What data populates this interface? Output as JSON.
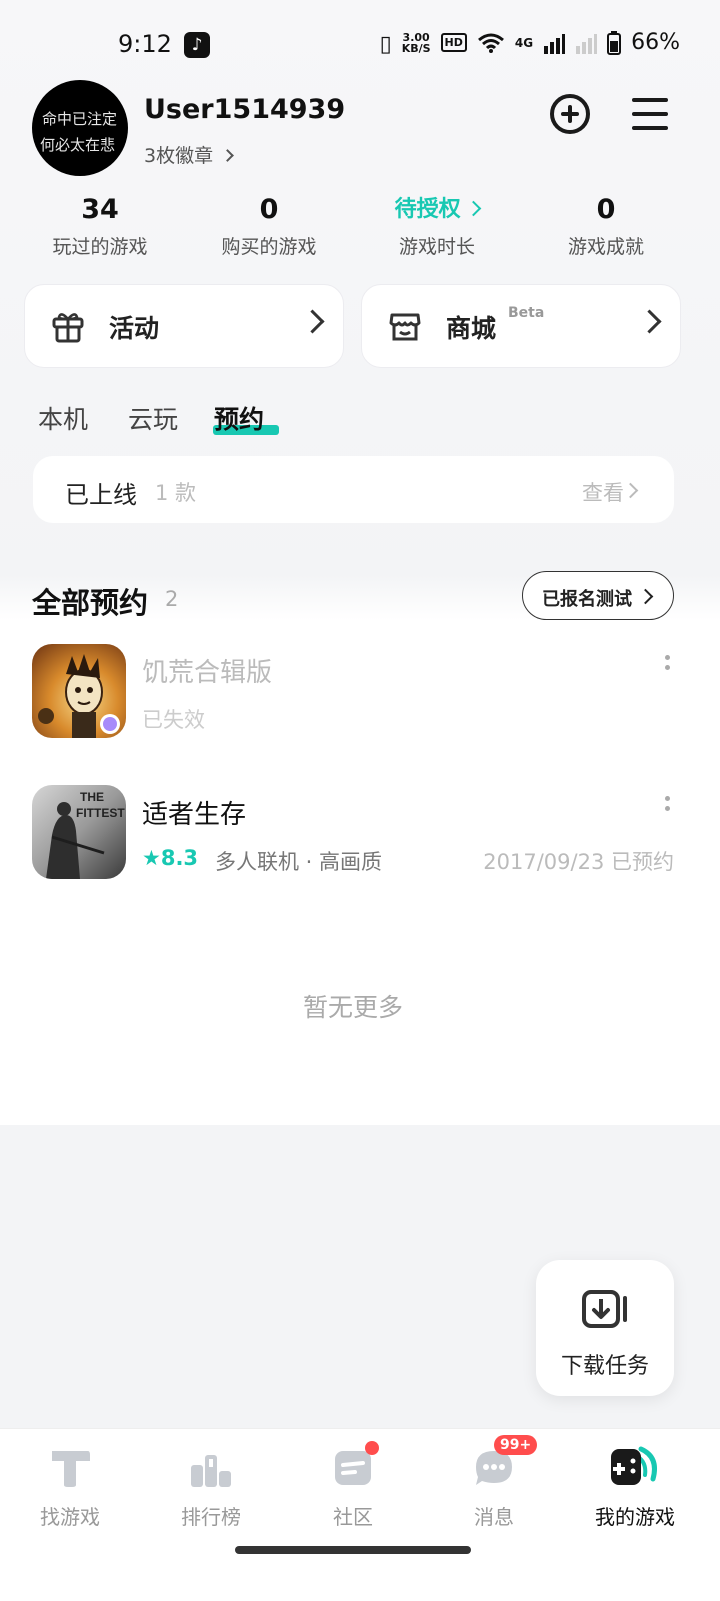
{
  "status_bar": {
    "time": "9:12",
    "net_speed_value": "3.00",
    "net_speed_unit": "KB/S",
    "hd_label": "HD",
    "network": "4G",
    "battery": "66%"
  },
  "profile": {
    "username": "User1514939",
    "badges": "3枚徽章",
    "avatar_text_line1": "命中已注定",
    "avatar_text_line2": "何必太在悲"
  },
  "stats": [
    {
      "value": "34",
      "label": "玩过的游戏"
    },
    {
      "value": "0",
      "label": "购买的游戏"
    },
    {
      "value": "待授权",
      "label": "游戏时长"
    },
    {
      "value": "0",
      "label": "游戏成就"
    }
  ],
  "cards": {
    "activity": "活动",
    "store": "商城",
    "store_tag": "Beta"
  },
  "tabs": [
    "本机",
    "云玩",
    "预约"
  ],
  "online": {
    "label": "已上线",
    "count": "1 款",
    "view": "查看"
  },
  "section": {
    "title": "全部预约",
    "count": "2",
    "test_button": "已报名测试"
  },
  "games": [
    {
      "name": "饥荒合辑版",
      "status": "已失效",
      "icon": "dont-starve-icon"
    },
    {
      "name": "适者生存",
      "rating": "8.3",
      "tags": "多人联机 · 高画质",
      "date": "2017/09/23 已预约",
      "icon": "the-fittest-icon",
      "icon_text_1": "THE",
      "icon_text_2": "FITTEST"
    }
  ],
  "no_more": "暂无更多",
  "fab": {
    "label": "下载任务"
  },
  "nav": [
    {
      "label": "找游戏",
      "icon": "find-games-icon"
    },
    {
      "label": "排行榜",
      "icon": "ranking-icon"
    },
    {
      "label": "社区",
      "icon": "community-icon"
    },
    {
      "label": "消息",
      "icon": "messages-icon",
      "badge": "99+"
    },
    {
      "label": "我的游戏",
      "icon": "my-games-icon"
    }
  ],
  "colors": {
    "accent": "#18c8b2",
    "badge": "#ff4d4d"
  }
}
